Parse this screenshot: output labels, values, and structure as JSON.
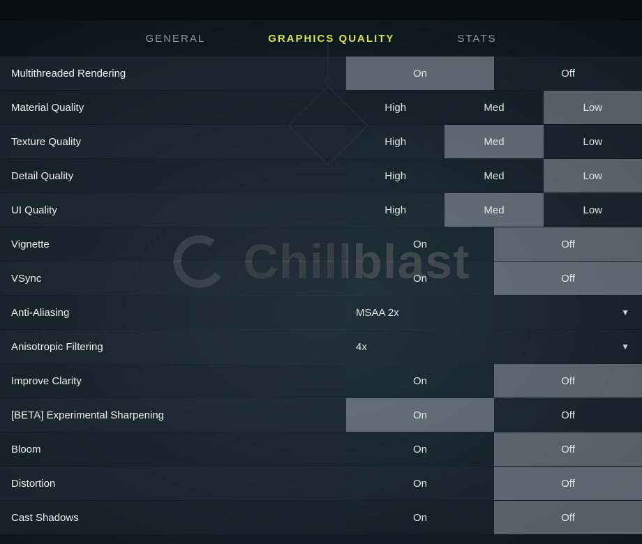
{
  "watermark": "Chillblast",
  "tabs": {
    "general": "GENERAL",
    "graphics": "GRAPHICS QUALITY",
    "stats": "STATS",
    "active": "graphics"
  },
  "options": {
    "on": "On",
    "off": "Off",
    "high": "High",
    "med": "Med",
    "low": "Low"
  },
  "settings": {
    "multithreaded_rendering": {
      "label": "Multithreaded Rendering",
      "type": "onoff",
      "value": "On"
    },
    "material_quality": {
      "label": "Material Quality",
      "type": "hml",
      "value": "Low"
    },
    "texture_quality": {
      "label": "Texture Quality",
      "type": "hml",
      "value": "Med"
    },
    "detail_quality": {
      "label": "Detail Quality",
      "type": "hml",
      "value": "Low"
    },
    "ui_quality": {
      "label": "UI Quality",
      "type": "hml",
      "value": "Med"
    },
    "vignette": {
      "label": "Vignette",
      "type": "onoff",
      "value": "Off"
    },
    "vsync": {
      "label": "VSync",
      "type": "onoff",
      "value": "Off"
    },
    "anti_aliasing": {
      "label": "Anti-Aliasing",
      "type": "dropdown",
      "value": "MSAA 2x"
    },
    "anisotropic_filtering": {
      "label": "Anisotropic Filtering",
      "type": "dropdown",
      "value": "4x"
    },
    "improve_clarity": {
      "label": "Improve Clarity",
      "type": "onoff",
      "value": "Off"
    },
    "experimental_sharpening": {
      "label": "[BETA] Experimental Sharpening",
      "type": "onoff",
      "value": "On"
    },
    "bloom": {
      "label": "Bloom",
      "type": "onoff",
      "value": "Off"
    },
    "distortion": {
      "label": "Distortion",
      "type": "onoff",
      "value": "Off"
    },
    "cast_shadows": {
      "label": "Cast Shadows",
      "type": "onoff",
      "value": "Off"
    }
  },
  "order": [
    "multithreaded_rendering",
    "material_quality",
    "texture_quality",
    "detail_quality",
    "ui_quality",
    "vignette",
    "vsync",
    "anti_aliasing",
    "anisotropic_filtering",
    "improve_clarity",
    "experimental_sharpening",
    "bloom",
    "distortion",
    "cast_shadows"
  ]
}
